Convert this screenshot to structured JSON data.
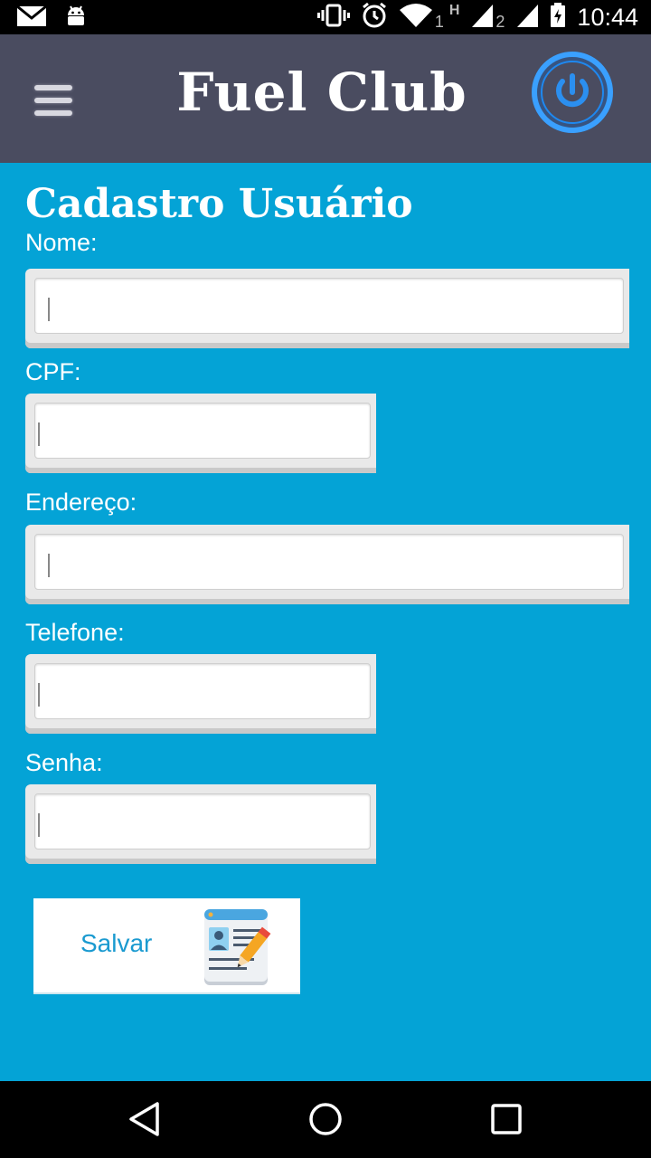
{
  "status_bar": {
    "time": "10:44",
    "sim1": "1",
    "sim2": "2",
    "network_type": "H",
    "icons": [
      "gmail-icon",
      "android-icon",
      "vibrate-icon",
      "alarm-icon",
      "wifi-icon",
      "signal-icon",
      "battery-charging-icon"
    ]
  },
  "header": {
    "title": "Fuel Club",
    "menu_icon": "hamburger-menu-icon",
    "power_icon": "power-icon"
  },
  "form": {
    "title": "Cadastro Usuário",
    "fields": [
      {
        "label": "Nome:",
        "value": "",
        "placeholder": ""
      },
      {
        "label": "CPF:",
        "value": "",
        "placeholder": ""
      },
      {
        "label": "Endereço:",
        "value": "",
        "placeholder": ""
      },
      {
        "label": "Telefone:",
        "value": "",
        "placeholder": ""
      },
      {
        "label": "Senha:",
        "value": "",
        "placeholder": ""
      }
    ],
    "save_button": {
      "label": "Salvar",
      "icon": "id-card-edit-icon"
    }
  },
  "navigation": {
    "icons": [
      "back-icon",
      "home-icon",
      "recents-icon"
    ]
  },
  "colors": {
    "background": "#04a3d6",
    "header": "#4a4c60",
    "power_ring": "#1e88f0",
    "save_text": "#1a9ad0"
  }
}
